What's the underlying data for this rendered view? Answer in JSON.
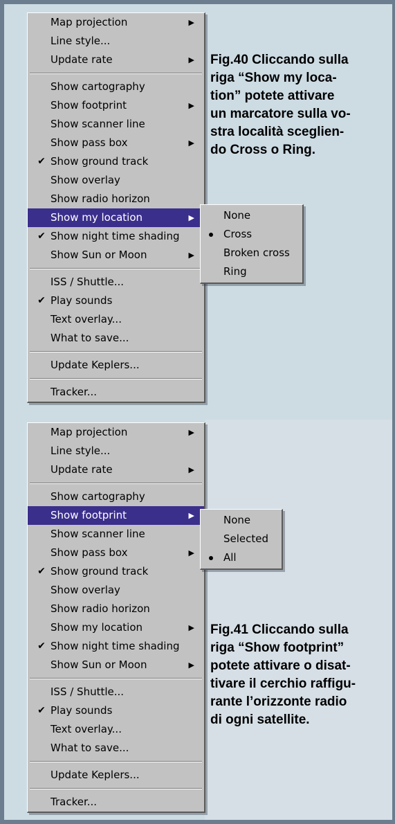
{
  "menu1": {
    "groups": [
      [
        {
          "label": "Map projection",
          "arrow": true
        },
        {
          "label": "Line style..."
        },
        {
          "label": "Update rate",
          "arrow": true
        }
      ],
      [
        {
          "label": "Show cartography"
        },
        {
          "label": "Show footprint",
          "arrow": true
        },
        {
          "label": "Show scanner line"
        },
        {
          "label": "Show pass box",
          "arrow": true
        },
        {
          "label": "Show ground track",
          "checked": true
        },
        {
          "label": "Show overlay"
        },
        {
          "label": "Show radio horizon"
        },
        {
          "label": "Show my location",
          "arrow": true,
          "highlighted": true
        },
        {
          "label": "Show night time shading",
          "checked": true
        },
        {
          "label": "Show Sun or Moon",
          "arrow": true
        }
      ],
      [
        {
          "label": "ISS / Shuttle..."
        },
        {
          "label": "Play sounds",
          "checked": true
        },
        {
          "label": "Text overlay..."
        },
        {
          "label": "What to save..."
        }
      ],
      [
        {
          "label": "Update Keplers..."
        }
      ],
      [
        {
          "label": "Tracker..."
        }
      ]
    ],
    "submenu": [
      {
        "label": "None"
      },
      {
        "label": "Cross",
        "selected": true
      },
      {
        "label": "Broken cross"
      },
      {
        "label": "Ring"
      }
    ]
  },
  "menu2": {
    "groups": [
      [
        {
          "label": "Map projection",
          "arrow": true
        },
        {
          "label": "Line style..."
        },
        {
          "label": "Update rate",
          "arrow": true
        }
      ],
      [
        {
          "label": "Show cartography"
        },
        {
          "label": "Show footprint",
          "arrow": true,
          "highlighted": true
        },
        {
          "label": "Show scanner line"
        },
        {
          "label": "Show pass box",
          "arrow": true
        },
        {
          "label": "Show ground track",
          "checked": true
        },
        {
          "label": "Show overlay"
        },
        {
          "label": "Show radio horizon"
        },
        {
          "label": "Show my location",
          "arrow": true
        },
        {
          "label": "Show night time shading",
          "checked": true
        },
        {
          "label": "Show Sun or Moon",
          "arrow": true
        }
      ],
      [
        {
          "label": "ISS / Shuttle..."
        },
        {
          "label": "Play sounds",
          "checked": true
        },
        {
          "label": "Text overlay..."
        },
        {
          "label": "What to save..."
        }
      ],
      [
        {
          "label": "Update Keplers..."
        }
      ],
      [
        {
          "label": "Tracker..."
        }
      ]
    ],
    "submenu": [
      {
        "label": "None"
      },
      {
        "label": "Selected"
      },
      {
        "label": "All",
        "selected": true
      }
    ]
  },
  "captions": {
    "fig40": {
      "lines": [
        "Fig.40 Cliccando sulla",
        "riga “Show my loca-",
        "tion” potete attivare",
        "un marcatore sulla vo-",
        "stra località sceglien-",
        "do Cross o Ring."
      ]
    },
    "fig41": {
      "lines": [
        "Fig.41 Cliccando sulla",
        "riga “Show footprint”",
        "potete attivare o disat-",
        "tivare il cerchio raffigu-",
        "rante l’orizzonte radio",
        "di ogni satellite."
      ]
    }
  },
  "symbols": {
    "check": "✔",
    "arrow": "▶"
  }
}
